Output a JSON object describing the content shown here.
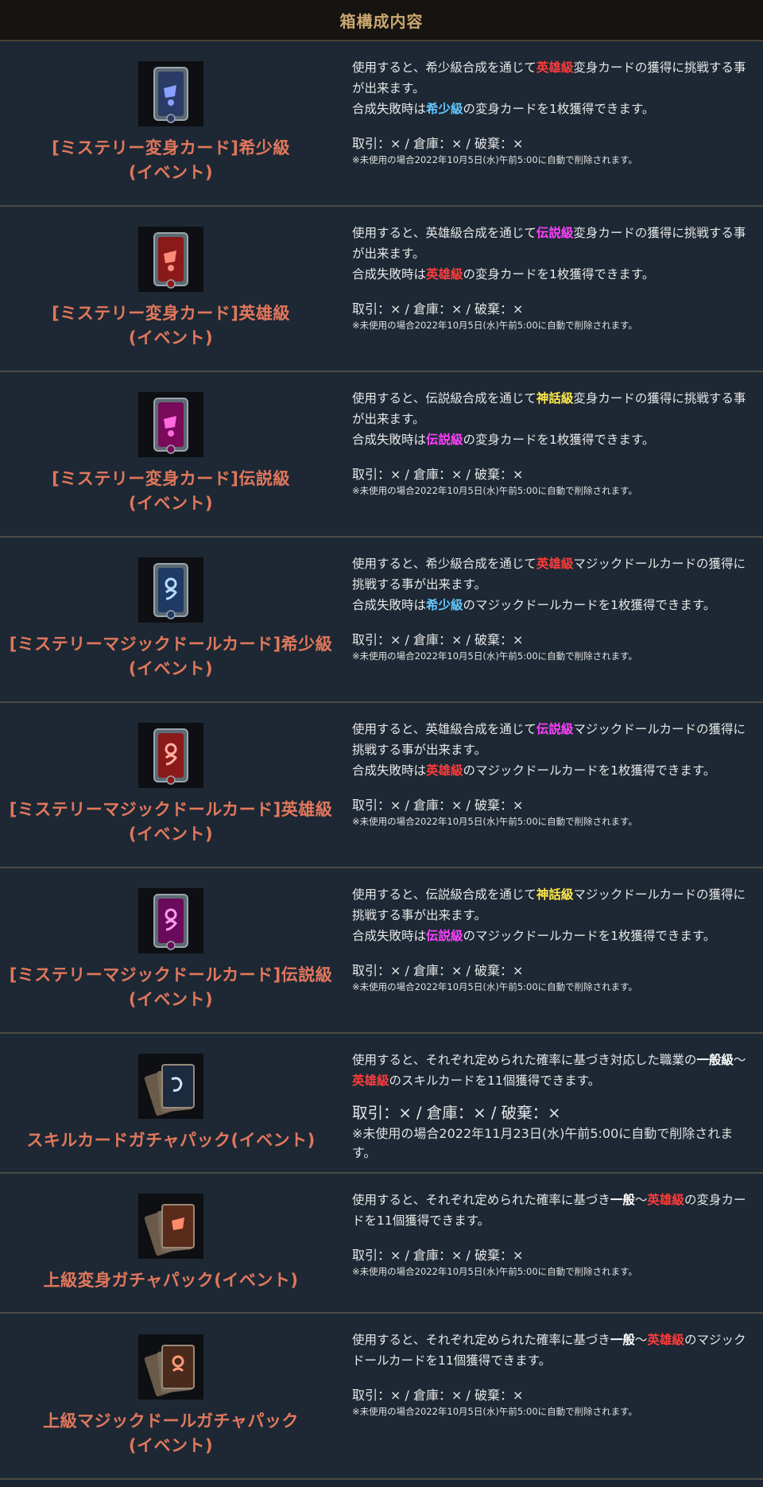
{
  "header": {
    "title": "箱構成内容"
  },
  "colors": {
    "hero": "#ff3b3b",
    "rare": "#63c7ff",
    "legend": "#ff40ff",
    "myth": "#ffe84a",
    "normal": "#ffffff",
    "name": "#e2775c",
    "gold": "#c9a86f"
  },
  "items": [
    {
      "name_line1": "[ミステリー変身カード]希少級",
      "name_line2": "(イベント)",
      "icon": "blue-shield-card-icon",
      "desc": [
        [
          {
            "t": "使用すると、希少級合成を通じて"
          },
          {
            "t": "英雄級",
            "c": "hero"
          },
          {
            "t": "変身カードの獲得に挑戦する事が出来ます。"
          }
        ],
        [
          {
            "t": "合成失敗時は"
          },
          {
            "t": "希少級",
            "c": "rare"
          },
          {
            "t": "の変身カードを1枚獲得できます。"
          }
        ]
      ],
      "trade": "取引：× / 倉庫：× / 破棄：×",
      "note": "※未使用の場合2022年10月5日(水)午前5:00に自動で削除されます。"
    },
    {
      "name_line1": "[ミステリー変身カード]英雄級",
      "name_line2": "(イベント)",
      "icon": "red-shield-card-icon",
      "desc": [
        [
          {
            "t": "使用すると、英雄級合成を通じて"
          },
          {
            "t": "伝説級",
            "c": "legend"
          },
          {
            "t": "変身カードの獲得に挑戦する事が出来ます。"
          }
        ],
        [
          {
            "t": "合成失敗時は"
          },
          {
            "t": "英雄級",
            "c": "hero"
          },
          {
            "t": "の変身カードを1枚獲得できます。"
          }
        ]
      ],
      "trade": "取引：× / 倉庫：× / 破棄：×",
      "note": "※未使用の場合2022年10月5日(水)午前5:00に自動で削除されます。"
    },
    {
      "name_line1": "[ミステリー変身カード]伝説級",
      "name_line2": "(イベント)",
      "icon": "magenta-shield-card-icon",
      "desc": [
        [
          {
            "t": "使用すると、伝説級合成を通じて"
          },
          {
            "t": "神話級",
            "c": "myth"
          },
          {
            "t": "変身カードの獲得に挑戦する事が出来ます。"
          }
        ],
        [
          {
            "t": "合成失敗時は"
          },
          {
            "t": "伝説級",
            "c": "legend"
          },
          {
            "t": "の変身カードを1枚獲得できます。"
          }
        ]
      ],
      "trade": "取引：× / 倉庫：× / 破棄：×",
      "note": "※未使用の場合2022年10月5日(水)午前5:00に自動で削除されます。"
    },
    {
      "name_line1": "[ミステリーマジックドールカード]希少級",
      "name_line2": "(イベント)",
      "icon": "blue-doll-card-icon",
      "desc": [
        [
          {
            "t": "使用すると、希少級合成を通じて"
          },
          {
            "t": "英雄級",
            "c": "hero"
          },
          {
            "t": "マジックドールカードの獲得に挑戦する事が出来ます。"
          }
        ],
        [
          {
            "t": "合成失敗時は"
          },
          {
            "t": "希少級",
            "c": "rare"
          },
          {
            "t": "のマジックドールカードを1枚獲得できます。"
          }
        ]
      ],
      "trade": "取引：× / 倉庫：× / 破棄：×",
      "note": "※未使用の場合2022年10月5日(水)午前5:00に自動で削除されます。"
    },
    {
      "name_line1": "[ミステリーマジックドールカード]英雄級",
      "name_line2": "(イベント)",
      "icon": "red-doll-card-icon",
      "desc": [
        [
          {
            "t": "使用すると、英雄級合成を通じて"
          },
          {
            "t": "伝説級",
            "c": "legend"
          },
          {
            "t": "マジックドールカードの獲得に挑戦する事が出来ます。"
          }
        ],
        [
          {
            "t": "合成失敗時は"
          },
          {
            "t": "英雄級",
            "c": "hero"
          },
          {
            "t": "のマジックドールカードを1枚獲得できます。"
          }
        ]
      ],
      "trade": "取引：× / 倉庫：× / 破棄：×",
      "note": "※未使用の場合2022年10月5日(水)午前5:00に自動で削除されます。"
    },
    {
      "name_line1": "[ミステリーマジックドールカード]伝説級",
      "name_line2": "(イベント)",
      "icon": "magenta-doll-card-icon",
      "desc": [
        [
          {
            "t": "使用すると、伝説級合成を通じて"
          },
          {
            "t": "神話級",
            "c": "myth"
          },
          {
            "t": "マジックドールカードの獲得に挑戦する事が出来ます。"
          }
        ],
        [
          {
            "t": "合成失敗時は"
          },
          {
            "t": "伝説級",
            "c": "legend"
          },
          {
            "t": "のマジックドールカードを1枚獲得できます。"
          }
        ]
      ],
      "trade": "取引：× / 倉庫：× / 破棄：×",
      "note": "※未使用の場合2022年10月5日(水)午前5:00に自動で削除されます。"
    },
    {
      "name_line1": "スキルカードガチャパック(イベント)",
      "name_line2": "",
      "icon": "skill-card-pack-icon",
      "big": true,
      "desc": [
        [
          {
            "t": "使用すると、それぞれ定められた確率に基づき対応した職業の"
          },
          {
            "t": "一般級",
            "c": "normal"
          },
          {
            "t": "～"
          },
          {
            "t": "英雄級",
            "c": "hero"
          },
          {
            "t": "のスキルカードを11個獲得できます。"
          }
        ]
      ],
      "trade": "取引：× / 倉庫：× / 破棄：×",
      "note": "※未使用の場合2022年11月23日(水)午前5:00に自動で削除されます。"
    },
    {
      "name_line1": "上級変身ガチャパック(イベント)",
      "name_line2": "",
      "icon": "transform-card-pack-icon",
      "desc": [
        [
          {
            "t": "使用すると、それぞれ定められた確率に基づき"
          },
          {
            "t": "一般",
            "c": "normal"
          },
          {
            "t": "～"
          },
          {
            "t": "英雄級",
            "c": "hero"
          },
          {
            "t": "の変身カードを11個獲得できます。"
          }
        ]
      ],
      "trade": "取引：× / 倉庫：× / 破棄：×",
      "note": "※未使用の場合2022年10月5日(水)午前5:00に自動で削除されます。"
    },
    {
      "name_line1": "上級マジックドールガチャパック",
      "name_line2": "(イベント)",
      "icon": "doll-card-pack-icon",
      "desc": [
        [
          {
            "t": "使用すると、それぞれ定められた確率に基づき"
          },
          {
            "t": "一般",
            "c": "normal"
          },
          {
            "t": "～"
          },
          {
            "t": "英雄級",
            "c": "hero"
          },
          {
            "t": "のマジックドールカードを11個獲得できます。"
          }
        ]
      ],
      "trade": "取引：× / 倉庫：× / 破棄：×",
      "note": "※未使用の場合2022年10月5日(水)午前5:00に自動で削除されます。"
    }
  ]
}
